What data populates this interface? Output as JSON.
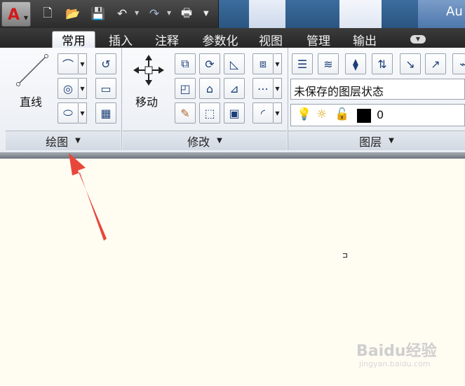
{
  "window": {
    "title": "Au"
  },
  "app_menu": {
    "logo": "A"
  },
  "quick_access": [
    {
      "name": "new",
      "glyph": "🗋"
    },
    {
      "name": "open",
      "glyph": "📂"
    },
    {
      "name": "save",
      "glyph": "💾"
    },
    {
      "name": "undo",
      "glyph": "↶"
    },
    {
      "name": "redo",
      "glyph": "↷"
    },
    {
      "name": "print",
      "glyph": "🖶"
    }
  ],
  "tabs": [
    "常用",
    "插入",
    "注释",
    "参数化",
    "视图",
    "管理",
    "输出"
  ],
  "active_tab": "常用",
  "panels": {
    "draw": {
      "title": "绘图",
      "big_button": "直线"
    },
    "modify": {
      "title": "修改",
      "big_button": "移动"
    },
    "layers": {
      "title": "图层",
      "layer_state": "未保存的图层状态",
      "current_layer": "0"
    }
  },
  "watermark": {
    "text": "Baidu经验",
    "sub": "jingyan.baidu.com"
  },
  "colors": {
    "accent": "#d21a1a",
    "ribbon_bg": "#eef1f5",
    "canvas": "#fffcf2",
    "arrow": "#e8473b"
  }
}
